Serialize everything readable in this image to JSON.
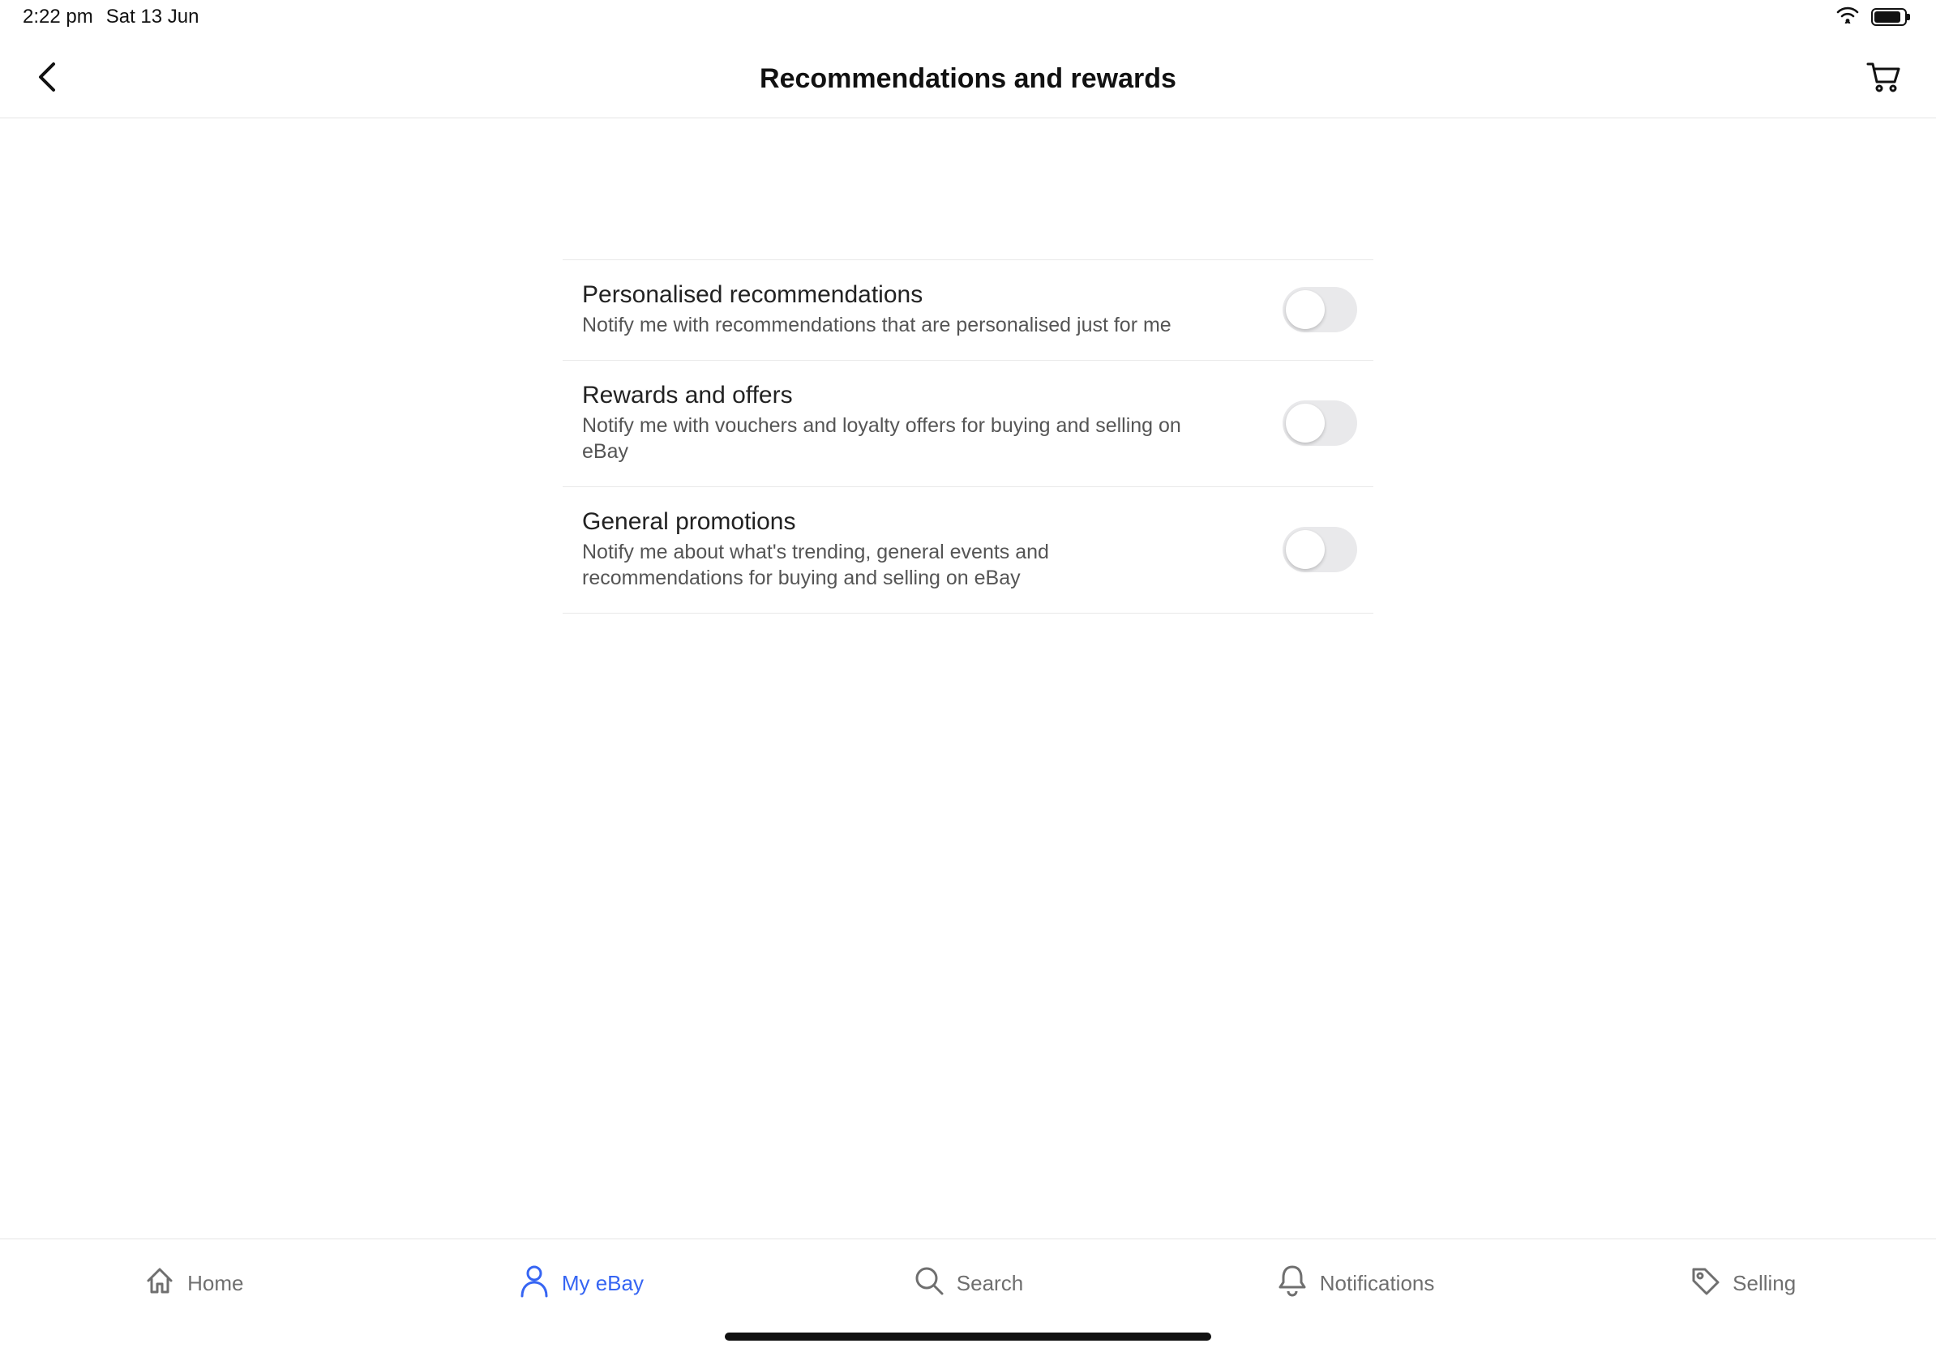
{
  "status": {
    "time": "2:22 pm",
    "date": "Sat 13 Jun"
  },
  "header": {
    "title": "Recommendations and rewards"
  },
  "settings": [
    {
      "title": "Personalised recommendations",
      "desc": "Notify me with recommendations that are personalised just for me",
      "on": false
    },
    {
      "title": "Rewards and offers",
      "desc": "Notify me with vouchers and loyalty offers for buying and selling on eBay",
      "on": false
    },
    {
      "title": "General promotions",
      "desc": "Notify me about what's trending, general events and recommendations for buying and selling on eBay",
      "on": false
    }
  ],
  "tabs": {
    "home": "Home",
    "myebay": "My eBay",
    "search": "Search",
    "notifications": "Notifications",
    "selling": "Selling"
  }
}
